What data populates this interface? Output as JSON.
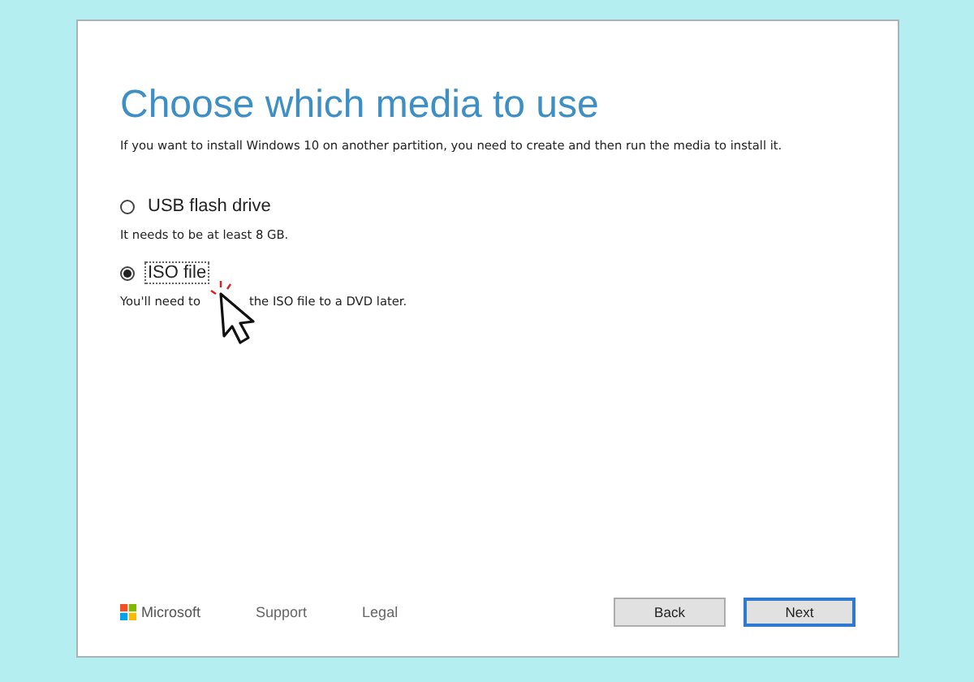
{
  "title": "Choose which media to use",
  "subtitle": "If you want to install Windows 10 on another partition, you need to create and then run the media to install it.",
  "options": [
    {
      "label": "USB flash drive",
      "description": [
        "It needs to be at least 8 GB."
      ],
      "selected": false
    },
    {
      "label": "ISO file",
      "description": [
        "You'll need to",
        "the ISO file to a DVD later."
      ],
      "selected": true
    }
  ],
  "footer": {
    "brand": "Microsoft",
    "links": [
      "Support",
      "Legal"
    ]
  },
  "buttons": [
    {
      "label": "Back",
      "kind": "normal"
    },
    {
      "label": "Next",
      "kind": "default"
    }
  ]
}
